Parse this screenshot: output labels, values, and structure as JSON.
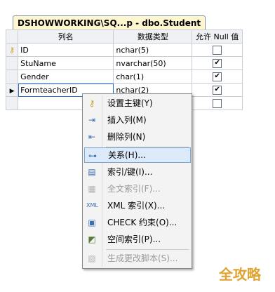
{
  "tab": {
    "title": "DSHOWWORKING\\SQ...p - dbo.Student"
  },
  "grid": {
    "headers": [
      "列名",
      "数据类型",
      "允许 Null 值"
    ],
    "rows": [
      {
        "name": "ID",
        "type": "nchar(5)",
        "allow_null": false,
        "primary_key": true
      },
      {
        "name": "StuName",
        "type": "nvarchar(50)",
        "allow_null": true,
        "primary_key": false
      },
      {
        "name": "Gender",
        "type": "char(1)",
        "allow_null": true,
        "primary_key": false
      },
      {
        "name": "FormteacherID",
        "type": "nchar(2)",
        "allow_null": true,
        "primary_key": false,
        "current": true
      },
      {
        "name": "",
        "type": "",
        "allow_null": false,
        "primary_key": false
      }
    ]
  },
  "context_menu": {
    "items": [
      {
        "label": "设置主键(Y)",
        "icon": "key-icon",
        "disabled": false,
        "highlighted": false
      },
      {
        "label": "插入列(M)",
        "icon": "insert-column-icon",
        "disabled": false,
        "highlighted": false
      },
      {
        "label": "删除列(N)",
        "icon": "delete-column-icon",
        "disabled": false,
        "highlighted": false
      },
      {
        "label": "关系(H)...",
        "icon": "relationship-icon",
        "disabled": false,
        "highlighted": true
      },
      {
        "label": "索引/键(I)...",
        "icon": "index-icon",
        "disabled": false,
        "highlighted": false
      },
      {
        "label": "全文索引(F)...",
        "icon": "fulltext-icon",
        "disabled": true,
        "highlighted": false
      },
      {
        "label": "XML 索引(X)...",
        "icon": "xml-index-icon",
        "disabled": false,
        "highlighted": false
      },
      {
        "label": "CHECK 约束(O)...",
        "icon": "check-constraint-icon",
        "disabled": false,
        "highlighted": false
      },
      {
        "label": "空间索引(P)...",
        "icon": "spatial-index-icon",
        "disabled": false,
        "highlighted": false
      },
      {
        "label": "生成更改脚本(S)...",
        "icon": "script-icon",
        "disabled": true,
        "highlighted": false
      }
    ]
  },
  "watermark": {
    "text": "全攻略"
  },
  "colors": {
    "highlight": "#dce9f8",
    "tab": "#fdf6cf",
    "watermark": "#e0a230"
  }
}
